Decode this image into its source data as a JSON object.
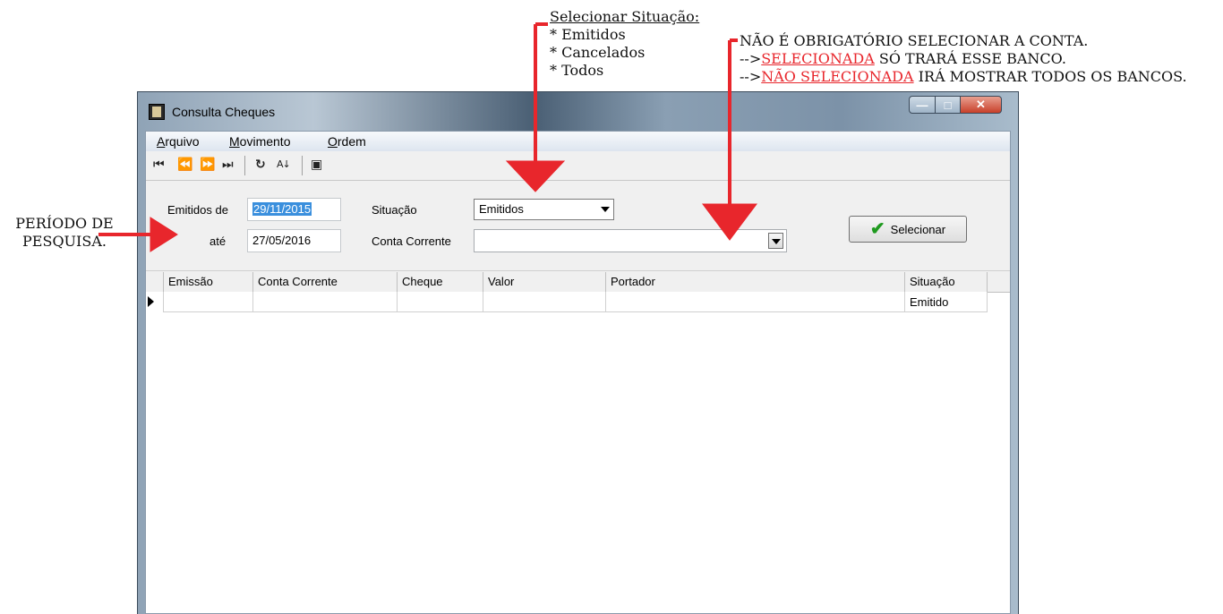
{
  "annotations": {
    "situacao": {
      "heading": "Selecionar Situação:",
      "items": [
        "* Emitidos",
        "* Cancelados",
        "* Todos"
      ]
    },
    "conta": {
      "line1": "NÃO É OBRIGATÓRIO SELECIONAR A CONTA.",
      "line2_prefix": "-->",
      "line2_red": "SELECIONADA",
      "line2_rest": " SÓ TRARÁ ESSE BANCO.",
      "line3_prefix": "-->",
      "line3_red": "NÃO SELECIONADA",
      "line3_rest": " IRÁ MOSTRAR TODOS OS BANCOS."
    },
    "periodo": {
      "line1": "PERÍODO DE",
      "line2": "PESQUISA."
    },
    "arrow_color": "#e8262c"
  },
  "window": {
    "title": "Consulta Cheques",
    "menu": [
      {
        "accel": "A",
        "rest": "rquivo"
      },
      {
        "accel": "M",
        "rest": "ovimento"
      },
      {
        "accel": "O",
        "rest": "rdem"
      }
    ],
    "toolbar": {
      "first": "⏮",
      "prev": "⏪",
      "next": "⏩",
      "last": "⏭",
      "refresh": "↻",
      "sort": "A↓",
      "props": "▣"
    }
  },
  "filters": {
    "emitidos_label": "Emitidos de",
    "from_date": "29/11/2015",
    "ate_label": "até",
    "to_date": "27/05/2016",
    "situacao_label": "Situação",
    "situacao_value": "Emitidos",
    "conta_label": "Conta Corrente",
    "conta_value": "",
    "select_button": "Selecionar"
  },
  "grid": {
    "columns": [
      "Emissão",
      "Conta Corrente",
      "Cheque",
      "Valor",
      "Portador",
      "Situação"
    ],
    "rows": [
      [
        "",
        "",
        "",
        "",
        "",
        "Emitido"
      ]
    ]
  }
}
